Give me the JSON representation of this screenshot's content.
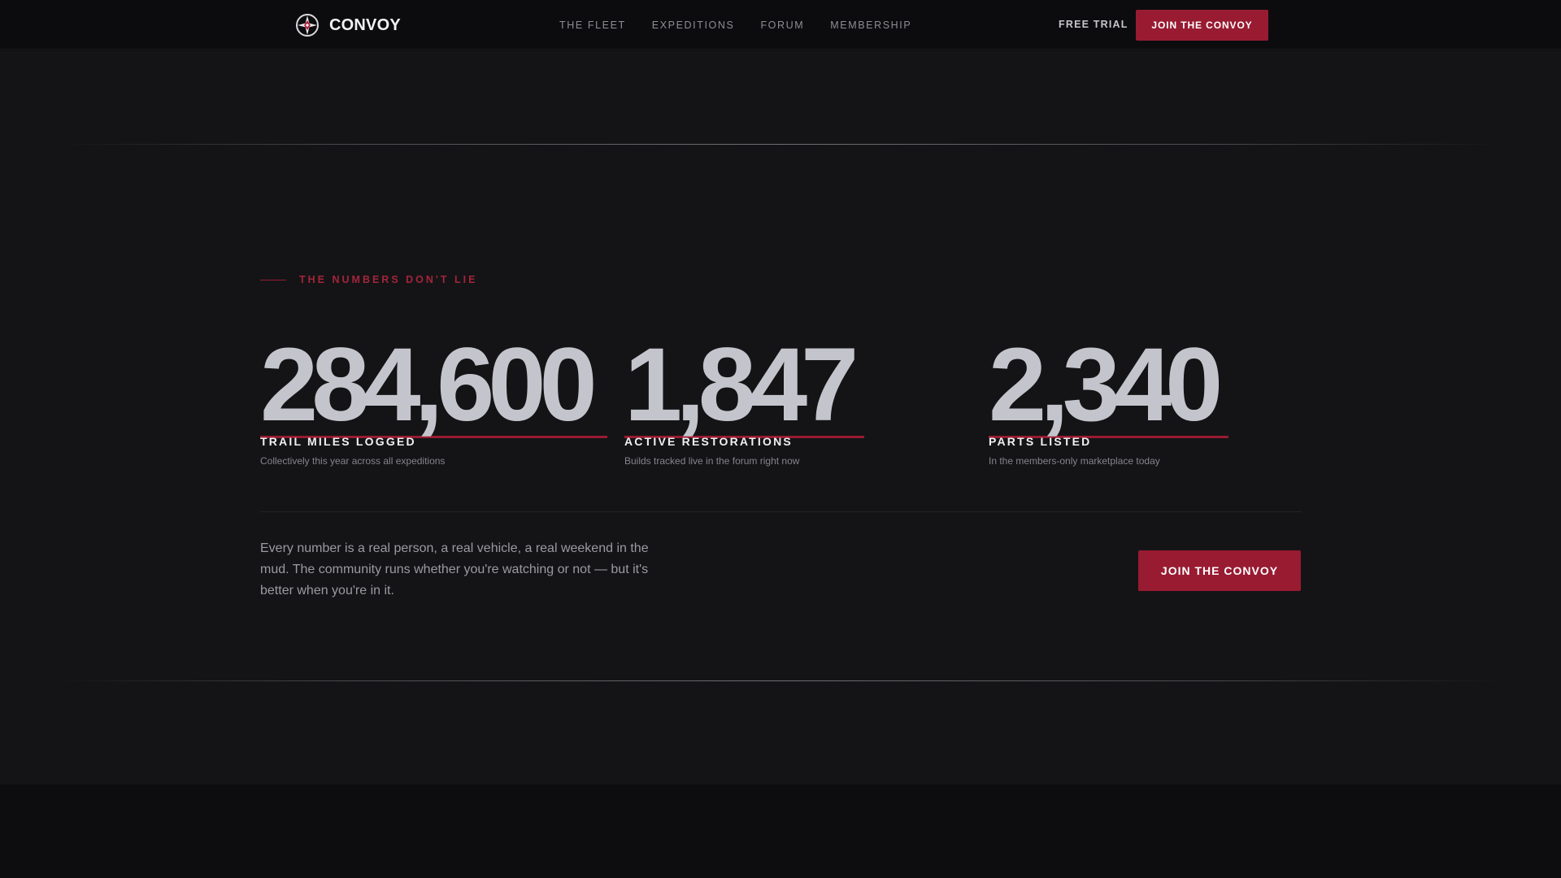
{
  "header": {
    "brand": "CONVOY",
    "nav": [
      "THE FLEET",
      "EXPEDITIONS",
      "FORUM",
      "MEMBERSHIP"
    ],
    "free_trial": "FREE TRIAL",
    "join_label": "JOIN THE CONVOY"
  },
  "stats_section": {
    "eyebrow": "THE NUMBERS DON'T LIE",
    "stats": [
      {
        "value": "284,600",
        "label": "TRAIL MILES LOGGED",
        "description": "Collectively this year across all expeditions"
      },
      {
        "value": "1,847",
        "label": "ACTIVE RESTORATIONS",
        "description": "Builds tracked live in the forum right now"
      },
      {
        "value": "2,340",
        "label": "PARTS LISTED",
        "description": "In the members-only marketplace today"
      }
    ],
    "closing_text": "Every number is a real person, a real vehicle, a real weekend in the mud. The community runs whether you're watching or not — but it's better when you're in it.",
    "cta_label": "JOIN THE CONVOY"
  },
  "colors": {
    "accent": "#981b32",
    "background": "#141416",
    "header_background": "#0c0c0e",
    "stat_number": "#c4c5cc"
  }
}
